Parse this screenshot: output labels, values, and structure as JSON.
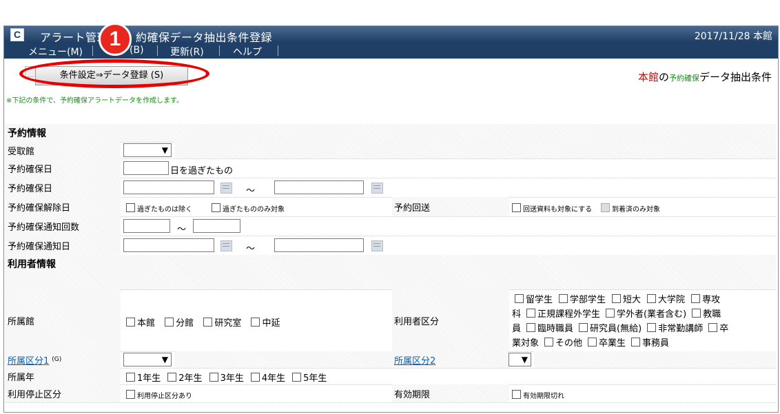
{
  "window": {
    "app_icon_letter": "C",
    "title_left": "アラート管理",
    "title_right": "約確保データ抽出条件登録",
    "date_location": "2017/11/28 本館"
  },
  "menu": [
    {
      "label": "メニュー(M)"
    },
    {
      "label": "(B)"
    },
    {
      "label": "更新(R)"
    },
    {
      "label": "ヘルプ"
    }
  ],
  "annotation": {
    "badge": "1"
  },
  "toolbar": {
    "condition_button": "条件設定⇒データ登録 (S)"
  },
  "header_right": {
    "place": "本館",
    "no": "の",
    "small": "予約確保",
    "rest": "データ抽出条件"
  },
  "note": "※下記の条件で、予約確保アラートデータを作成します。",
  "sections": {
    "reservation": "予約情報",
    "user": "利用者情報"
  },
  "fields": {
    "receiving_library": "受取館",
    "days_passed_label": "予約確保日",
    "days_passed_suffix": "日を過ぎたもの",
    "reserve_date": "予約確保日",
    "tilde": "～",
    "cancel_date": "予約確保解除日",
    "cancel_opt1": "過ぎたものは除く",
    "cancel_opt2": "過ぎたもののみ対象",
    "reply": "予約回送",
    "reply_opt1": "回送資料も対象にする",
    "reply_opt2": "到着済のみ対象",
    "notice_count": "予約確保通知回数",
    "notice_date": "予約確保通知日",
    "affiliation": "所属館",
    "affiliation_opts": [
      "本館",
      "分館",
      "研究室",
      "中延"
    ],
    "user_type": "利用者区分",
    "user_type_lines": [
      [
        "留学生",
        "学部学生",
        "短大",
        "大学院",
        "専攻"
      ],
      [
        "科",
        "正規課程外学生",
        "学外者(業者含む)",
        "教職"
      ],
      [
        "員",
        "臨時職員",
        "研究員(無給)",
        "非常勤講師",
        "卒"
      ],
      [
        "業対象",
        "その他",
        "卒業生",
        "事務員"
      ]
    ],
    "div1": "所属区分1",
    "div1_suffix": "(G)",
    "div2": "所属区分2",
    "year": "所属年",
    "year_opts": [
      "1年生",
      "2年生",
      "3年生",
      "4年生",
      "5年生"
    ],
    "suspend": "利用停止区分",
    "suspend_opt": "利用停止区分あり",
    "expire": "有効期限",
    "expire_opt": "有効期限切れ"
  }
}
